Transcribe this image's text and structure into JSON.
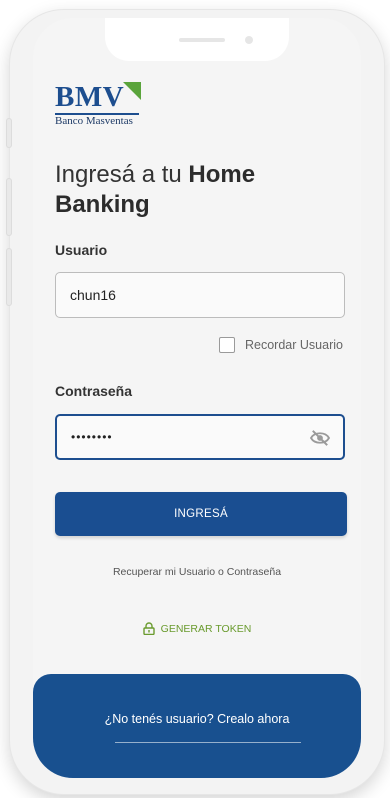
{
  "brand": {
    "logo_text": "BMV",
    "logo_subtitle": "Banco Masventas",
    "primary_color": "#1a4e91",
    "accent_color": "#6a9b2e"
  },
  "login": {
    "title_regular": "Ingresá a tu ",
    "title_bold_1": "Home",
    "title_bold_2": "Banking",
    "username_label": "Usuario",
    "username_value": "chun16",
    "remember_label": "Recordar Usuario",
    "remember_checked": false,
    "password_label": "Contraseña",
    "password_value": "••••••••",
    "password_visibility_icon": "eye-off-icon",
    "submit_label": "INGRESÁ",
    "recover_link": "Recuperar mi Usuario o Contraseña",
    "token_label": "GENERAR TOKEN",
    "token_icon": "lock-icon"
  },
  "footer": {
    "signup_text": "¿No tenés usuario? Crealo ahora"
  }
}
